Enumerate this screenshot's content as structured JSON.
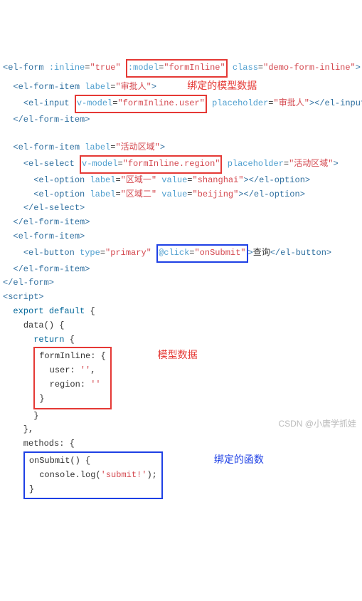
{
  "lines": {
    "l1_open": "<el-form :inline=\"true\"",
    "l1_boxed": ":model=\"formInline\"",
    "l1_close": "class=\"demo-form-inline\">",
    "annotation1": "绑定的模型数据",
    "l2": "<el-form-item label=\"审批人\">",
    "l3_open": "<el-input",
    "l3_boxed": "v-model=\"formInline.user\"",
    "l3_close": "placeholder=\"审批人\"></el-input>",
    "l4": "</el-form-item>",
    "l5": "<el-form-item label=\"活动区域\">",
    "l6_open": "<el-select",
    "l6_boxed": "v-model=\"formInline.region\"",
    "l6_close": "placeholder=\"活动区域\">",
    "l7": "<el-option label=\"区域一\" value=\"shanghai\"></el-option>",
    "l8": "<el-option label=\"区域二\" value=\"beijing\"></el-option>",
    "l9": "</el-select>",
    "l10": "</el-form-item>",
    "l11": "<el-form-item>",
    "l12_open": "<el-button type=\"primary\"",
    "l12_boxed": "@click=\"onSubmit\"",
    "l12_text": ">查询</el-button>",
    "l13": "</el-form-item>",
    "l14": "</el-form>",
    "l15": "<script>",
    "l16": "export default {",
    "l17": "data() {",
    "l18": "return {",
    "l19": "formInline: {",
    "l20": "user: '',",
    "l21": "region: ''",
    "l22": "}",
    "annotation2": "模型数据",
    "l23": "}",
    "l24": "},",
    "l25": "methods: {",
    "l26": "onSubmit() {",
    "l27": "console.log('submit!');",
    "l28": "}",
    "annotation3": "绑定的函数"
  },
  "watermark": "CSDN @小唐学抓娃"
}
